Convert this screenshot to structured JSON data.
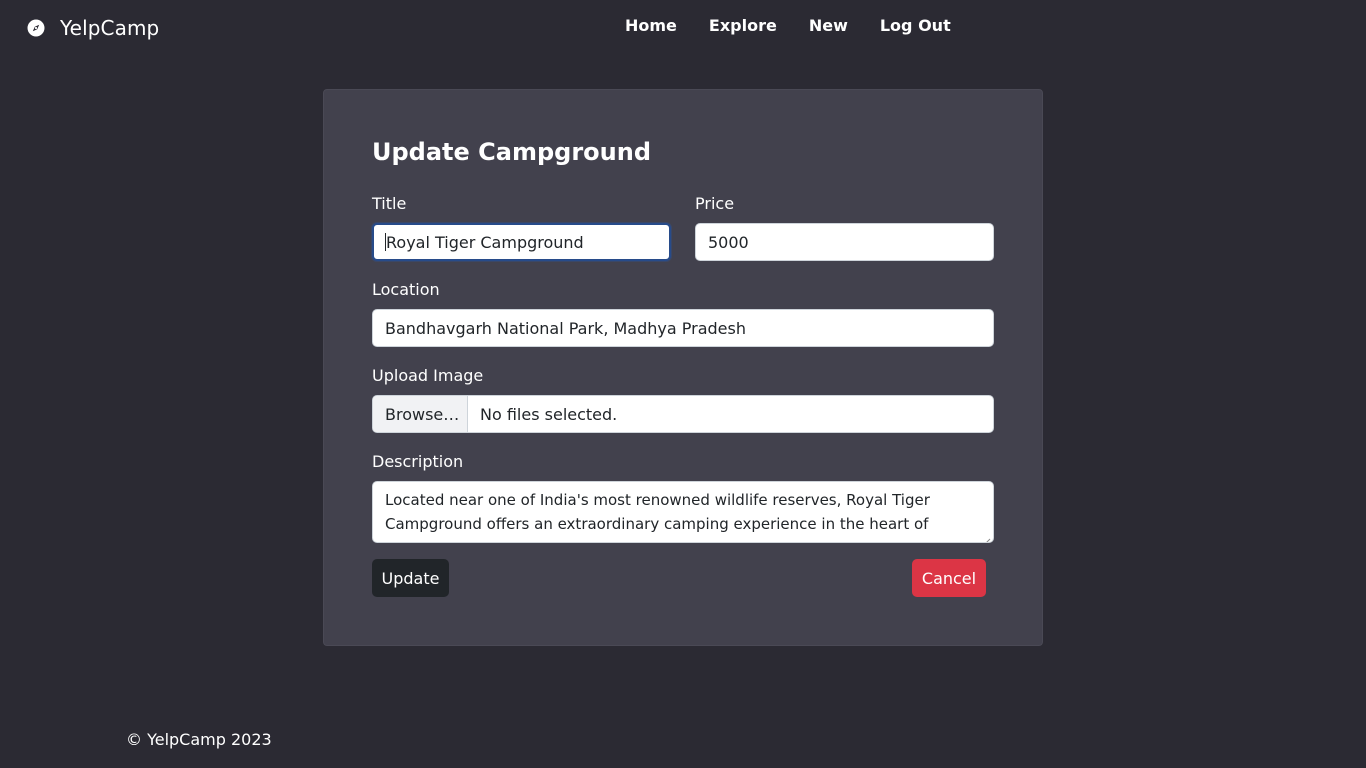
{
  "navbar": {
    "brand": "YelpCamp",
    "brand_icon": "compass-icon",
    "links": [
      "Home",
      "Explore",
      "New",
      "Log Out"
    ]
  },
  "form": {
    "heading": "Update Campground",
    "title_label": "Title",
    "title_value": "Royal Tiger Campground",
    "price_label": "Price",
    "price_value": "5000",
    "location_label": "Location",
    "location_value": "Bandhavgarh National Park, Madhya Pradesh",
    "image_label": "Upload Image",
    "browse_label": "Browse…",
    "file_status": "No files selected.",
    "description_label": "Description",
    "description_value": "Located near one of India's most renowned wildlife reserves, Royal Tiger Campground offers an extraordinary camping experience in the heart of nature. Set",
    "update_button": "Update",
    "cancel_button": "Cancel"
  },
  "footer": {
    "text": "© YelpCamp 2023"
  },
  "colors": {
    "background": "#2b2a33",
    "card": "#42414d",
    "update_button": "#212529",
    "cancel_button": "#dc3545",
    "focus_border": "#274b8a"
  }
}
